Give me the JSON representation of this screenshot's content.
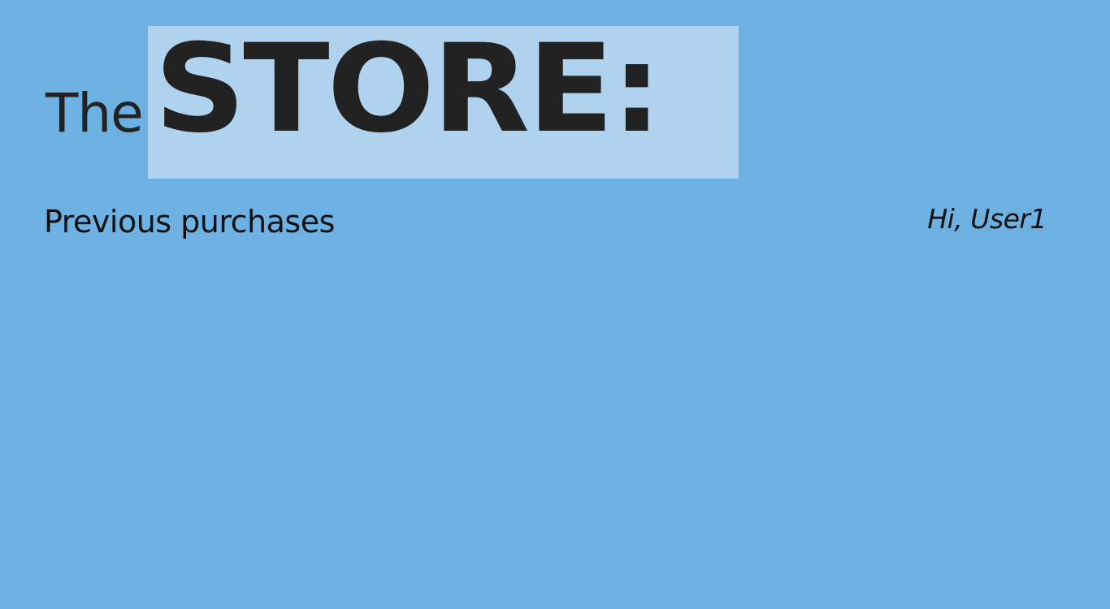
{
  "header": {
    "logo_prefix": "The",
    "logo_word": "STORE:",
    "logo_box_color": "#afd3ef"
  },
  "nav": {
    "previous_purchases_label": "Previous purchases"
  },
  "user": {
    "greeting": "Hi, User1"
  },
  "colors": {
    "background": "#6cb1e2",
    "text": "#222222"
  }
}
